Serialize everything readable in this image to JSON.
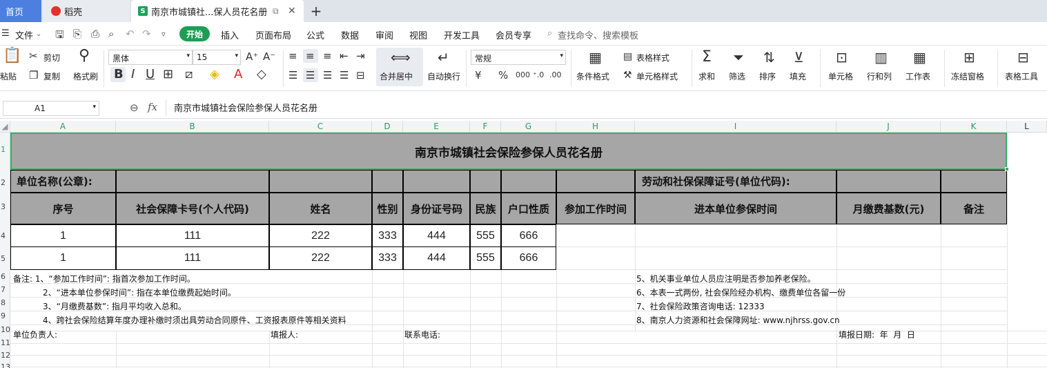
{
  "tabs": {
    "home": "首页",
    "daoke": "稻壳",
    "active": "南京市城镇社...保人员花名册"
  },
  "menu": {
    "file": "文件",
    "start": "开始",
    "insert": "插入",
    "layout": "页面布局",
    "formula": "公式",
    "data": "数据",
    "review": "审阅",
    "view": "视图",
    "dev": "开发工具",
    "vip": "会员专享",
    "search": "查找命令、搜索模板"
  },
  "ribbon": {
    "paste": "粘贴",
    "cut": "剪切",
    "copy": "复制",
    "format_painter": "格式刷",
    "font_name": "黑体",
    "font_size": "15",
    "merge": "合并居中",
    "wrap": "自动换行",
    "num_format": "常规",
    "cond_format": "条件格式",
    "table_style": "表格样式",
    "cell_style": "单元格样式",
    "sum": "求和",
    "filter": "筛选",
    "sort": "排序",
    "fill": "填充",
    "cell": "单元格",
    "rowcol": "行和列",
    "sheet": "工作表",
    "freeze": "冻结窗格",
    "tools": "表格工具"
  },
  "formula_bar": {
    "cell_ref": "A1",
    "fx": "fx",
    "content": "南京市城镇社会保险参保人员花名册"
  },
  "columns": [
    "A",
    "B",
    "C",
    "D",
    "E",
    "F",
    "G",
    "H",
    "I",
    "J",
    "K",
    "L"
  ],
  "rows": [
    "1",
    "2",
    "3",
    "4",
    "5",
    "6",
    "7",
    "8",
    "9",
    "10",
    "11",
    "12",
    "13"
  ],
  "sheet": {
    "title": "南京市城镇社会保险参保人员花名册",
    "unit_name": "单位名称(公章):",
    "labor_no": "劳动和社保保障证号(单位代码):",
    "headers": [
      "序号",
      "社会保障卡号(个人代码)",
      "姓名",
      "性别",
      "身份证号码",
      "民族",
      "户口性质",
      "参加工作时间",
      "进本单位参保时间",
      "月缴费基数(元)",
      "备注"
    ],
    "rows": [
      [
        "1",
        "111",
        "222",
        "333",
        "444",
        "555",
        "666"
      ],
      [
        "1",
        "111",
        "222",
        "333",
        "444",
        "555",
        "666"
      ]
    ],
    "notes_left": [
      "备注: 1、“参加工作时间”: 指首次参加工作时间。",
      "2、“进本单位参保时间”: 指在本单位缴费起始时间。",
      "3、“月缴费基数”: 指月平均收入总和。",
      "4、跨社会保险结算年度办理补缴时须出具劳动合同原件、工资报表原件等相关资料"
    ],
    "notes_right": [
      "5、机关事业单位人员应注明是否参加养老保险。",
      "6、本表一式两份, 社会保险经办机构、缴费单位各留一份",
      "7、社会保险政策咨询电话: 12333",
      "8、南京人力资源和社会保障网址: www.njhrss.gov.cn"
    ],
    "footer": {
      "leader": "单位负责人:",
      "filler": "填报人:",
      "phone": "联系电话:",
      "date": "填报日期:  年  月  日"
    }
  }
}
